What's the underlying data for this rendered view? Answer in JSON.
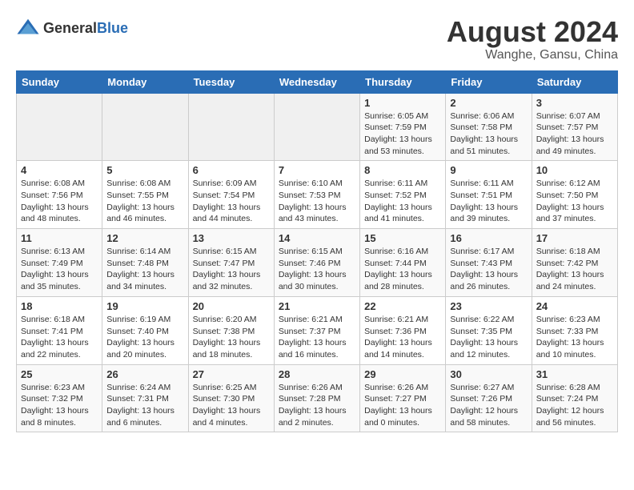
{
  "header": {
    "logo_general": "General",
    "logo_blue": "Blue",
    "month_year": "August 2024",
    "location": "Wanghe, Gansu, China"
  },
  "days_of_week": [
    "Sunday",
    "Monday",
    "Tuesday",
    "Wednesday",
    "Thursday",
    "Friday",
    "Saturday"
  ],
  "weeks": [
    [
      {
        "day": "",
        "info": ""
      },
      {
        "day": "",
        "info": ""
      },
      {
        "day": "",
        "info": ""
      },
      {
        "day": "",
        "info": ""
      },
      {
        "day": "1",
        "info": "Sunrise: 6:05 AM\nSunset: 7:59 PM\nDaylight: 13 hours\nand 53 minutes."
      },
      {
        "day": "2",
        "info": "Sunrise: 6:06 AM\nSunset: 7:58 PM\nDaylight: 13 hours\nand 51 minutes."
      },
      {
        "day": "3",
        "info": "Sunrise: 6:07 AM\nSunset: 7:57 PM\nDaylight: 13 hours\nand 49 minutes."
      }
    ],
    [
      {
        "day": "4",
        "info": "Sunrise: 6:08 AM\nSunset: 7:56 PM\nDaylight: 13 hours\nand 48 minutes."
      },
      {
        "day": "5",
        "info": "Sunrise: 6:08 AM\nSunset: 7:55 PM\nDaylight: 13 hours\nand 46 minutes."
      },
      {
        "day": "6",
        "info": "Sunrise: 6:09 AM\nSunset: 7:54 PM\nDaylight: 13 hours\nand 44 minutes."
      },
      {
        "day": "7",
        "info": "Sunrise: 6:10 AM\nSunset: 7:53 PM\nDaylight: 13 hours\nand 43 minutes."
      },
      {
        "day": "8",
        "info": "Sunrise: 6:11 AM\nSunset: 7:52 PM\nDaylight: 13 hours\nand 41 minutes."
      },
      {
        "day": "9",
        "info": "Sunrise: 6:11 AM\nSunset: 7:51 PM\nDaylight: 13 hours\nand 39 minutes."
      },
      {
        "day": "10",
        "info": "Sunrise: 6:12 AM\nSunset: 7:50 PM\nDaylight: 13 hours\nand 37 minutes."
      }
    ],
    [
      {
        "day": "11",
        "info": "Sunrise: 6:13 AM\nSunset: 7:49 PM\nDaylight: 13 hours\nand 35 minutes."
      },
      {
        "day": "12",
        "info": "Sunrise: 6:14 AM\nSunset: 7:48 PM\nDaylight: 13 hours\nand 34 minutes."
      },
      {
        "day": "13",
        "info": "Sunrise: 6:15 AM\nSunset: 7:47 PM\nDaylight: 13 hours\nand 32 minutes."
      },
      {
        "day": "14",
        "info": "Sunrise: 6:15 AM\nSunset: 7:46 PM\nDaylight: 13 hours\nand 30 minutes."
      },
      {
        "day": "15",
        "info": "Sunrise: 6:16 AM\nSunset: 7:44 PM\nDaylight: 13 hours\nand 28 minutes."
      },
      {
        "day": "16",
        "info": "Sunrise: 6:17 AM\nSunset: 7:43 PM\nDaylight: 13 hours\nand 26 minutes."
      },
      {
        "day": "17",
        "info": "Sunrise: 6:18 AM\nSunset: 7:42 PM\nDaylight: 13 hours\nand 24 minutes."
      }
    ],
    [
      {
        "day": "18",
        "info": "Sunrise: 6:18 AM\nSunset: 7:41 PM\nDaylight: 13 hours\nand 22 minutes."
      },
      {
        "day": "19",
        "info": "Sunrise: 6:19 AM\nSunset: 7:40 PM\nDaylight: 13 hours\nand 20 minutes."
      },
      {
        "day": "20",
        "info": "Sunrise: 6:20 AM\nSunset: 7:38 PM\nDaylight: 13 hours\nand 18 minutes."
      },
      {
        "day": "21",
        "info": "Sunrise: 6:21 AM\nSunset: 7:37 PM\nDaylight: 13 hours\nand 16 minutes."
      },
      {
        "day": "22",
        "info": "Sunrise: 6:21 AM\nSunset: 7:36 PM\nDaylight: 13 hours\nand 14 minutes."
      },
      {
        "day": "23",
        "info": "Sunrise: 6:22 AM\nSunset: 7:35 PM\nDaylight: 13 hours\nand 12 minutes."
      },
      {
        "day": "24",
        "info": "Sunrise: 6:23 AM\nSunset: 7:33 PM\nDaylight: 13 hours\nand 10 minutes."
      }
    ],
    [
      {
        "day": "25",
        "info": "Sunrise: 6:23 AM\nSunset: 7:32 PM\nDaylight: 13 hours\nand 8 minutes."
      },
      {
        "day": "26",
        "info": "Sunrise: 6:24 AM\nSunset: 7:31 PM\nDaylight: 13 hours\nand 6 minutes."
      },
      {
        "day": "27",
        "info": "Sunrise: 6:25 AM\nSunset: 7:30 PM\nDaylight: 13 hours\nand 4 minutes."
      },
      {
        "day": "28",
        "info": "Sunrise: 6:26 AM\nSunset: 7:28 PM\nDaylight: 13 hours\nand 2 minutes."
      },
      {
        "day": "29",
        "info": "Sunrise: 6:26 AM\nSunset: 7:27 PM\nDaylight: 13 hours\nand 0 minutes."
      },
      {
        "day": "30",
        "info": "Sunrise: 6:27 AM\nSunset: 7:26 PM\nDaylight: 12 hours\nand 58 minutes."
      },
      {
        "day": "31",
        "info": "Sunrise: 6:28 AM\nSunset: 7:24 PM\nDaylight: 12 hours\nand 56 minutes."
      }
    ]
  ]
}
